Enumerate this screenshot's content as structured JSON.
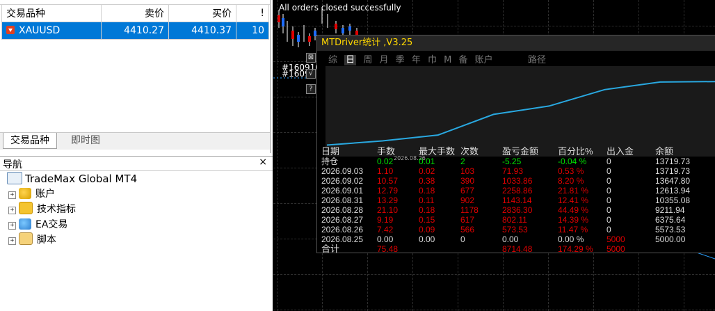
{
  "market_watch": {
    "columns": [
      "交易品种",
      "卖价",
      "买价",
      "!"
    ],
    "rows": [
      {
        "symbol": "XAUUSD",
        "bid": "4410.27",
        "ask": "4410.37",
        "spread": "10"
      }
    ],
    "tabs": [
      "交易品种",
      "即时图"
    ]
  },
  "navigator": {
    "title": "导航",
    "close": "×",
    "root": "TradeMax Global MT4",
    "items": [
      {
        "label": "账户",
        "icon": "account-icon"
      },
      {
        "label": "技术指标",
        "icon": "indicator-icon"
      },
      {
        "label": "EA交易",
        "icon": "expert-advisor-icon"
      },
      {
        "label": "脚本",
        "icon": "script-icon"
      }
    ]
  },
  "chart": {
    "message": "All orders closed successfully",
    "order_labels": [
      "#160910",
      "#1609"
    ],
    "side_buttons": [
      "⊠",
      "√",
      "?"
    ]
  },
  "stats_panel": {
    "title": "MTDriver统计 ,V3.25",
    "tabs": [
      "综",
      "日",
      "周",
      "月",
      "季",
      "年",
      "巾",
      "M",
      "备",
      "账户"
    ],
    "active_tab": "日",
    "path_label": "路径",
    "equity_date": "2026.08.26",
    "equity_curve": [
      5000.0,
      5573.53,
      6375.64,
      9211.94,
      10355.08,
      12613.94,
      13647.8,
      13719.73
    ],
    "headers": [
      "日期",
      "手数",
      "最大手数",
      "次数",
      "盈亏金额",
      "百分比%",
      "出入金",
      "余额"
    ],
    "open_row": {
      "date": "持仓",
      "lots": "0.02",
      "max_lots": "0.01",
      "count": "2",
      "pnl": "-5.25",
      "pct": "-0.04 %",
      "deposit": "0",
      "balance": "13719.73"
    },
    "rows": [
      {
        "date": "2026.09.03",
        "lots": "1.10",
        "max_lots": "0.02",
        "count": "103",
        "pnl": "71.93",
        "pct": "0.53 %",
        "deposit": "0",
        "balance": "13719.73"
      },
      {
        "date": "2026.09.02",
        "lots": "10.57",
        "max_lots": "0.38",
        "count": "390",
        "pnl": "1033.86",
        "pct": "8.20 %",
        "deposit": "0",
        "balance": "13647.80"
      },
      {
        "date": "2026.09.01",
        "lots": "12.79",
        "max_lots": "0.18",
        "count": "677",
        "pnl": "2258.86",
        "pct": "21.81 %",
        "deposit": "0",
        "balance": "12613.94"
      },
      {
        "date": "2026.08.31",
        "lots": "13.29",
        "max_lots": "0.11",
        "count": "902",
        "pnl": "1143.14",
        "pct": "12.41 %",
        "deposit": "0",
        "balance": "10355.08"
      },
      {
        "date": "2026.08.28",
        "lots": "21.10",
        "max_lots": "0.18",
        "count": "1178",
        "pnl": "2836.30",
        "pct": "44.49 %",
        "deposit": "0",
        "balance": "9211.94"
      },
      {
        "date": "2026.08.27",
        "lots": "9.19",
        "max_lots": "0.15",
        "count": "617",
        "pnl": "802.11",
        "pct": "14.39 %",
        "deposit": "0",
        "balance": "6375.64"
      },
      {
        "date": "2026.08.26",
        "lots": "7.42",
        "max_lots": "0.09",
        "count": "566",
        "pnl": "573.53",
        "pct": "11.47 %",
        "deposit": "0",
        "balance": "5573.53"
      },
      {
        "date": "2026.08.25",
        "lots": "0.00",
        "max_lots": "0.00",
        "count": "0",
        "pnl": "0.00",
        "pct": "0.00 %",
        "deposit": "5000",
        "balance": "5000.00"
      }
    ],
    "total_row": {
      "date": "合计",
      "lots": "75.48",
      "pnl": "8714.48",
      "pct": "174.29 %",
      "deposit": "5000"
    },
    "colors": {
      "positive": "#e00000",
      "open": "#00e000",
      "text": "#dddddd",
      "title": "#ffd700",
      "curve": "#29a8e0"
    }
  }
}
